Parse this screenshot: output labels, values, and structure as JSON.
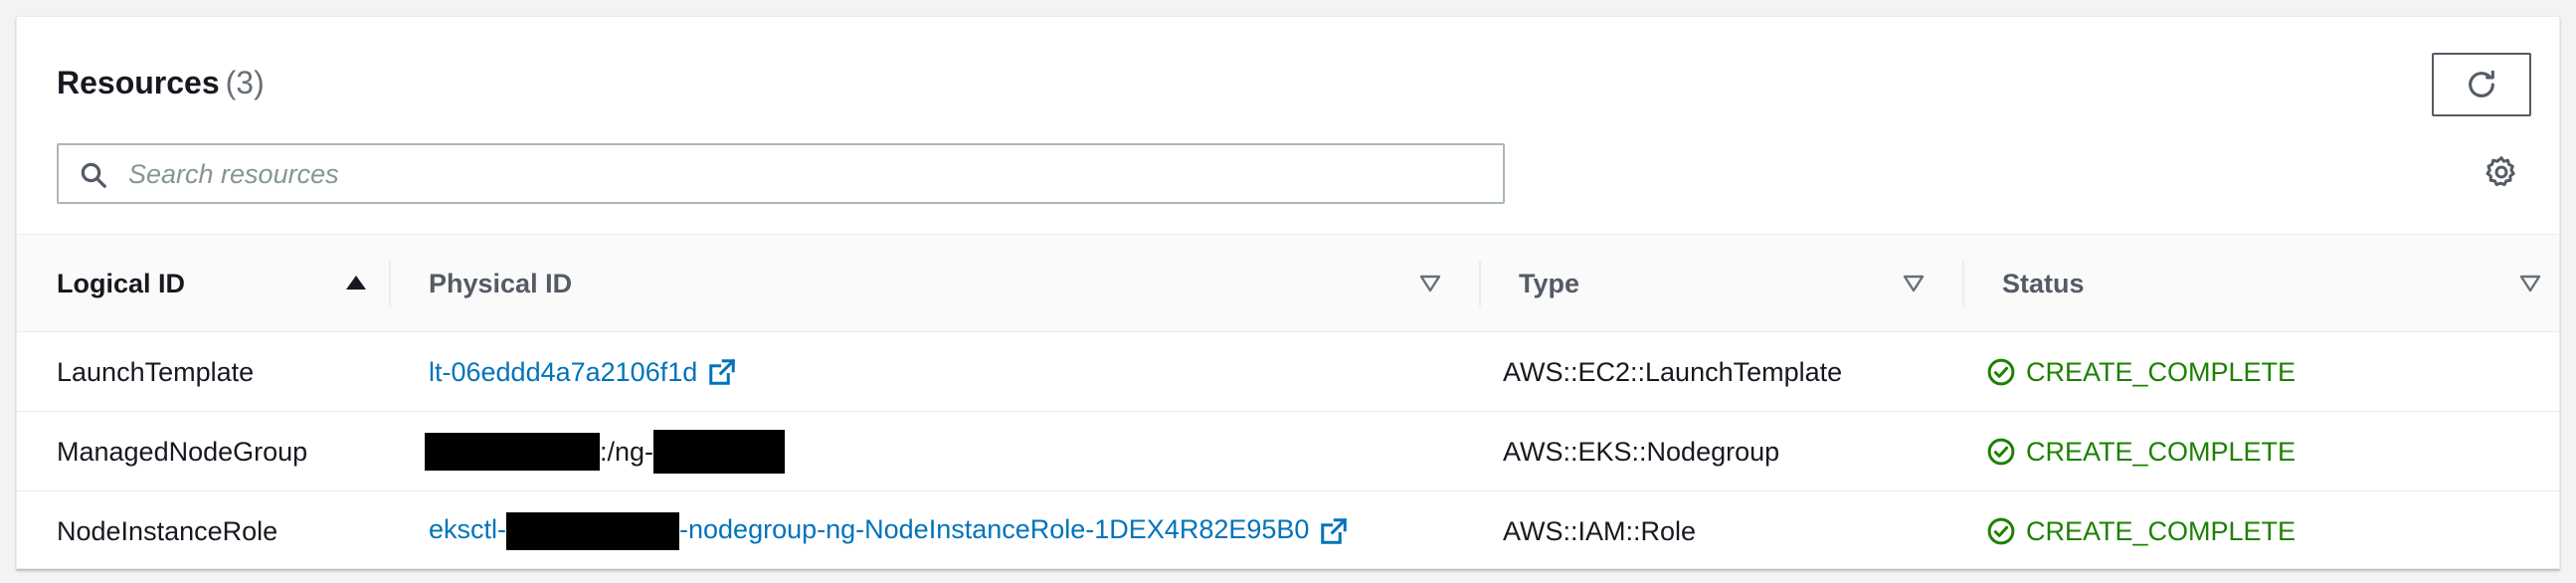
{
  "header": {
    "title": "Resources",
    "count": "(3)"
  },
  "search": {
    "placeholder": "Search resources",
    "value": ""
  },
  "columns": [
    {
      "label": "Logical ID",
      "sort": "ascending"
    },
    {
      "label": "Physical ID",
      "sort": "none"
    },
    {
      "label": "Type",
      "sort": "none"
    },
    {
      "label": "Status",
      "sort": "none"
    }
  ],
  "rows": [
    {
      "logical_id": "LaunchTemplate",
      "physical_id": "lt-06eddd4a7a2106f1d",
      "type": "AWS::EC2::LaunchTemplate",
      "status": "CREATE_COMPLETE"
    },
    {
      "logical_id": "ManagedNodeGroup",
      "physical_id_visible_text": ":/ng-",
      "type": "AWS::EKS::Nodegroup",
      "status": "CREATE_COMPLETE"
    },
    {
      "logical_id": "NodeInstanceRole",
      "physical_id_prefix": "eksctl-",
      "physical_id_suffix": "-nodegroup-ng-NodeInstanceRole-1DEX4R82E95B0",
      "type": "AWS::IAM::Role",
      "status": "CREATE_COMPLETE"
    }
  ],
  "icons": {
    "refresh": "refresh-icon",
    "search": "search-icon",
    "settings": "gear-icon",
    "sort_ascending": "caret-up-filled-icon",
    "sort_none": "caret-down-outline-icon",
    "external_link": "external-link-icon",
    "status_success": "check-circle-icon"
  },
  "colors": {
    "link": "#0073bb",
    "success": "#1d8102",
    "header_bg": "#fafafa",
    "page_bg": "#f2f3f3"
  }
}
